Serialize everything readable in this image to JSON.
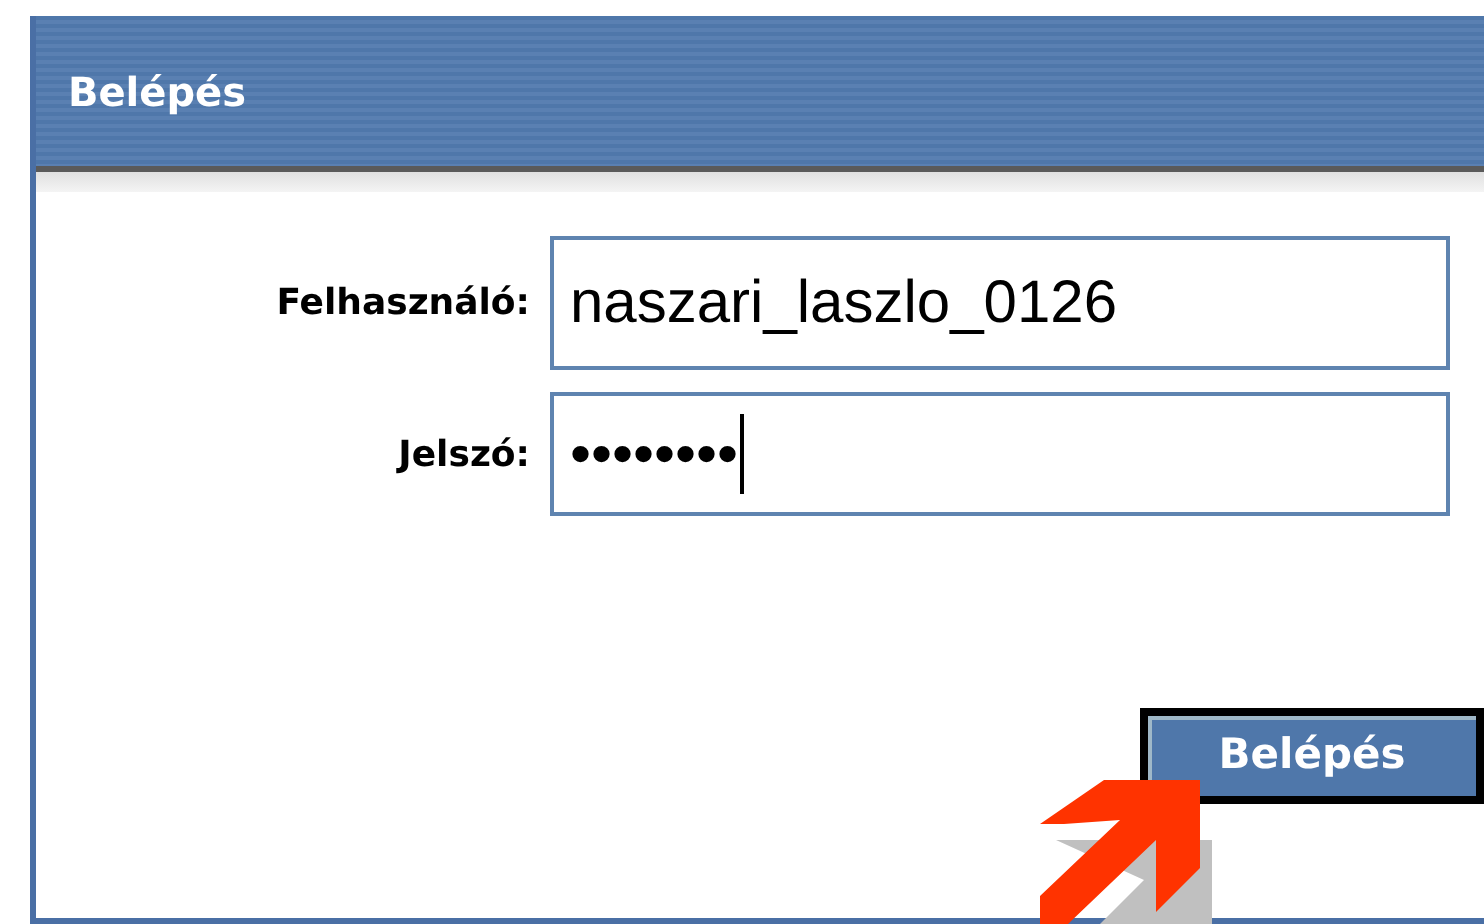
{
  "panel": {
    "title": "Belépés"
  },
  "fields": [
    {
      "label": "Felhasználó:",
      "value": "naszari_laszlo_0126",
      "focused": false
    },
    {
      "label": "Jelszó:",
      "value": "••••••••",
      "focused": true
    }
  ],
  "button": {
    "label": "Belépés"
  }
}
